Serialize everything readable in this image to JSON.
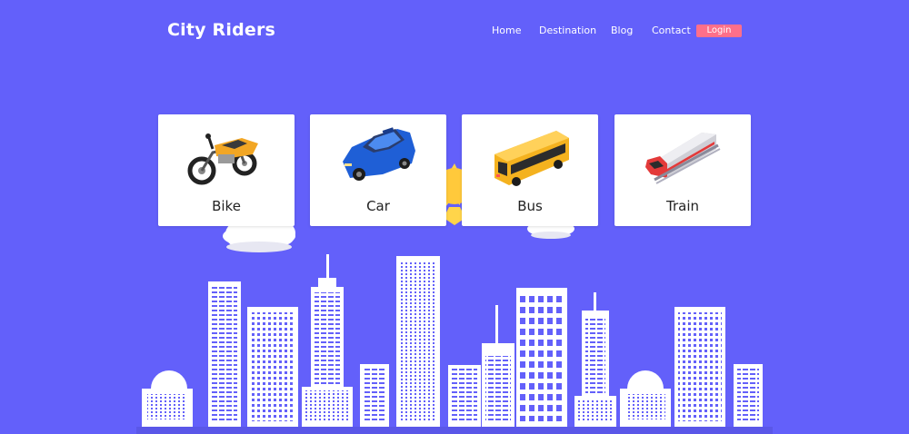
{
  "header": {
    "brand": "City Riders",
    "nav": [
      {
        "label": "Home"
      },
      {
        "label": "Destination"
      },
      {
        "label": "Blog"
      },
      {
        "label": "Contact"
      }
    ],
    "login_label": "Login"
  },
  "vehicles": [
    {
      "label": "Bike",
      "icon": "motorbike-icon"
    },
    {
      "label": "Car",
      "icon": "car-icon"
    },
    {
      "label": "Bus",
      "icon": "bus-icon"
    },
    {
      "label": "Train",
      "icon": "train-icon"
    }
  ],
  "colors": {
    "background": "#6360fa",
    "login_button": "#ff6f8a",
    "building": "#ffffff",
    "window": "#6360fa"
  }
}
